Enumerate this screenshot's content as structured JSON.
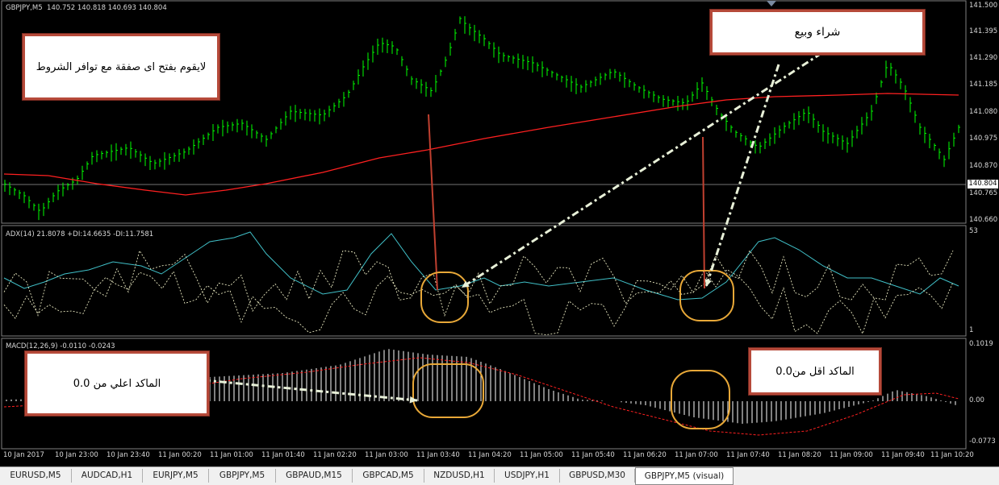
{
  "chart_header": {
    "symbol": "GBPJPY,M5",
    "ohlc": "140.752 140.818 140.693 140.804"
  },
  "adx_header": "ADX(14) 21.8078 +DI:14.6635 -DI:11.7581",
  "macd_header": "MACD(12,26,9) -0.0110 -0.0243",
  "price_axis": [
    "141.500",
    "141.395",
    "141.290",
    "141.185",
    "141.080",
    "140.975",
    "140.870",
    "140.765",
    "140.660"
  ],
  "current_price": "140.804",
  "adx_axis": [
    "53",
    "1"
  ],
  "macd_axis": [
    "0.1019",
    "0.00",
    "-0.0773"
  ],
  "time_axis": [
    "10 Jan 2017",
    "10 Jan 23:00",
    "10 Jan 23:40",
    "11 Jan 00:20",
    "11 Jan 01:00",
    "11 Jan 01:40",
    "11 Jan 02:20",
    "11 Jan 03:00",
    "11 Jan 03:40",
    "11 Jan 04:20",
    "11 Jan 05:00",
    "11 Jan 05:40",
    "11 Jan 06:20",
    "11 Jan 07:00",
    "11 Jan 07:40",
    "11 Jan 08:20",
    "11 Jan 09:00",
    "11 Jan 09:40",
    "11 Jan 10:20"
  ],
  "annotations": {
    "no_trade": "لايقوم بفتح اى صفقة مع توافر الشروط",
    "buy_sell": "شراء وبيع",
    "macd_above": "الماكد اعلي من 0.0",
    "macd_below": "الماكد اقل من0.0"
  },
  "tabs": [
    "EURUSD,M5",
    "AUDCAD,H1",
    "EURJPY,M5",
    "GBPJPY,M5",
    "GBPAUD,M15",
    "GBPCAD,M5",
    "NZDUSD,H1",
    "USDJPY,H1",
    "GBPUSD,M30",
    "GBPJPY,M5 (visual)"
  ],
  "active_tab": "GBPJPY,M5 (visual)",
  "colors": {
    "background": "#000000",
    "candles": "#00ff00",
    "moving_average": "#ff2020",
    "adx_line": "#40c0c8",
    "di_lines": "#e8e8c0",
    "macd_hist": "#ffffff",
    "macd_signal": "#ff2020",
    "highlight_circle": "#e8a838",
    "arrow": "#e8f0d8",
    "pointer_line": "#c04030",
    "note_border": "#b64a3a"
  }
}
